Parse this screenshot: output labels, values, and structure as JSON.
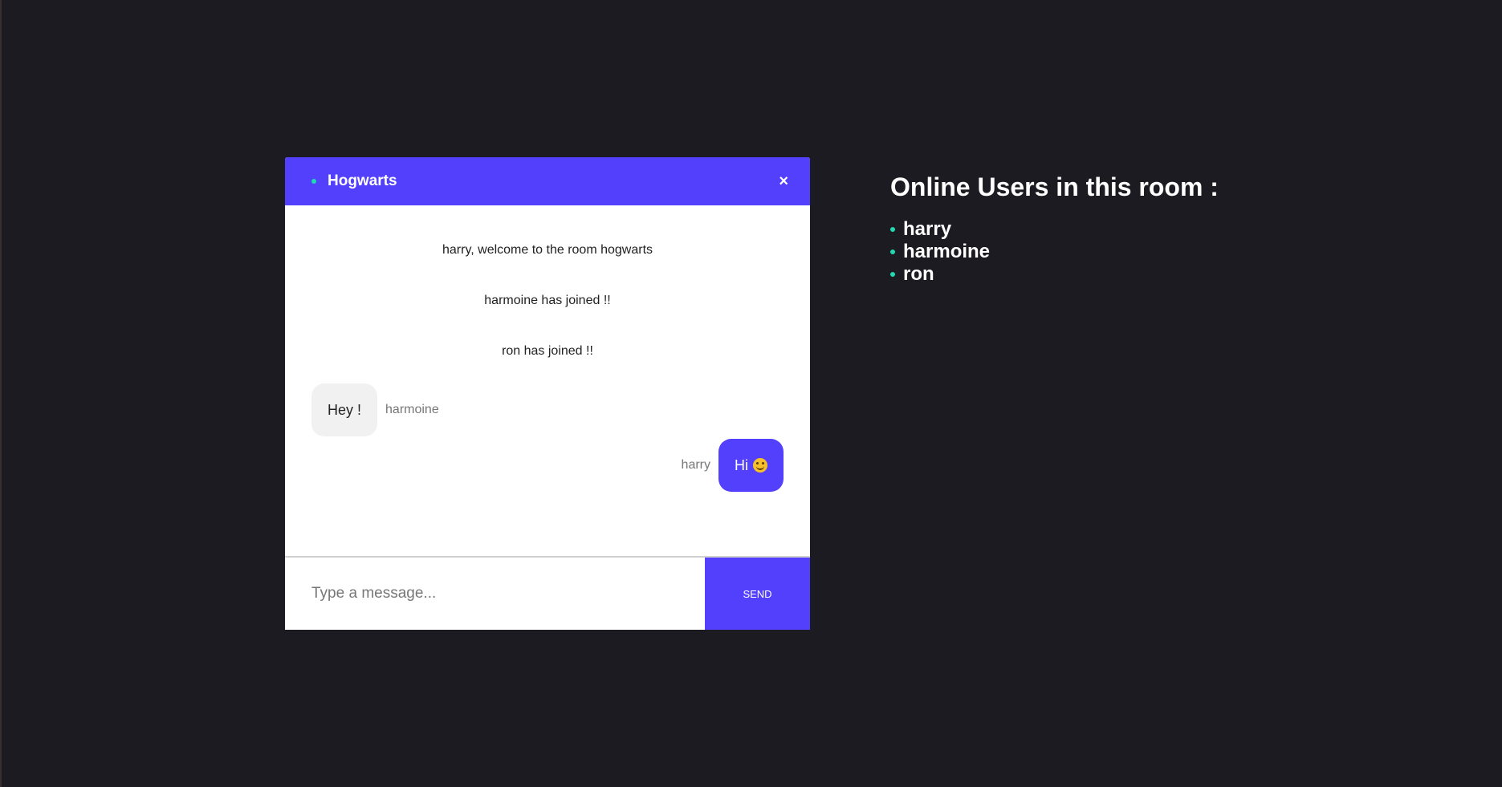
{
  "chat": {
    "room_name": "Hogwarts",
    "close_symbol": "×",
    "system_messages": [
      "harry, welcome to the room hogwarts",
      "harmoine has joined !!",
      "ron has joined !!"
    ],
    "messages": [
      {
        "text": "Hey !",
        "sender": "harmoine",
        "direction": "incoming"
      },
      {
        "text": "Hi",
        "sender": "harry",
        "direction": "outgoing",
        "emoji": "smile-icon"
      }
    ],
    "input_placeholder": "Type a message...",
    "send_label": "SEND"
  },
  "users_panel": {
    "heading": "Online Users in this room :",
    "users": [
      "harry",
      "harmoine",
      "ron"
    ]
  },
  "colors": {
    "accent": "#5240fd",
    "online": "#20d9b0",
    "background": "#1c1b21"
  }
}
